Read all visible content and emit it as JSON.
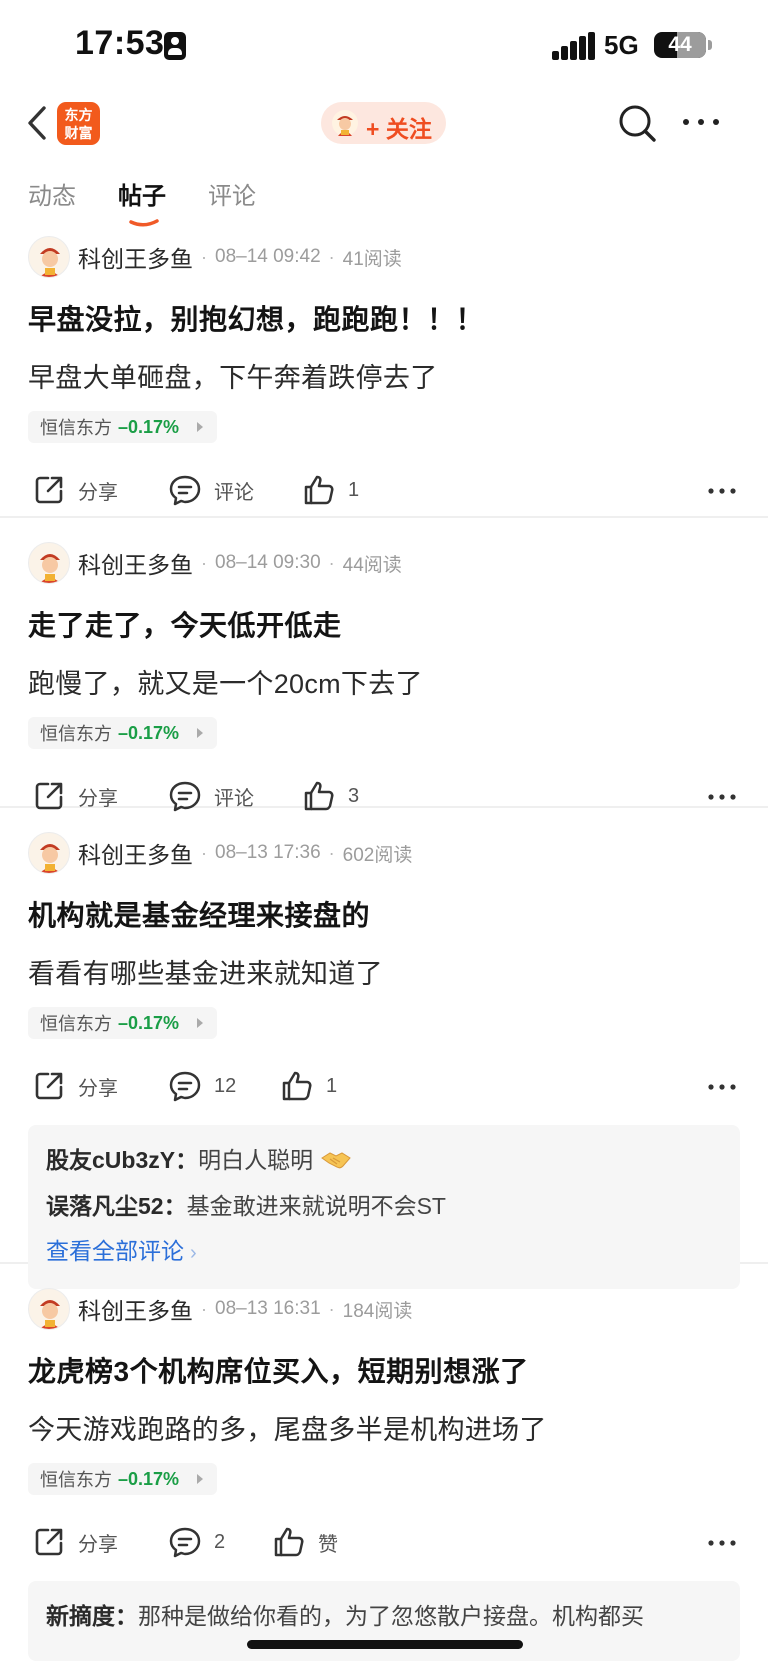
{
  "status_bar": {
    "time": "17:53",
    "network": "5G",
    "battery": "44",
    "battery_level": 0.44
  },
  "nav": {
    "logo_text": "东方财富",
    "follow_label": "+ 关注"
  },
  "tabs": [
    {
      "label": "动态",
      "active": false
    },
    {
      "label": "帖子",
      "active": true
    },
    {
      "label": "评论",
      "active": false
    }
  ],
  "posts": [
    {
      "author": "科创王多鱼",
      "time": "08–14 09:42",
      "reads": "41阅读",
      "title": "早盘没拉，别抱幻想，跑跑跑！！！",
      "body": "早盘大单砸盘，下午奔着跌停去了",
      "stock": {
        "name": "恒信东方",
        "change": "–0.17%"
      },
      "share": "分享",
      "comment": "评论",
      "like": "1"
    },
    {
      "author": "科创王多鱼",
      "time": "08–14 09:30",
      "reads": "44阅读",
      "title": "走了走了，今天低开低走",
      "body": "跑慢了，就又是一个20cm下去了",
      "stock": {
        "name": "恒信东方",
        "change": "–0.17%"
      },
      "share": "分享",
      "comment": "评论",
      "like": "3"
    },
    {
      "author": "科创王多鱼",
      "time": "08–13 17:36",
      "reads": "602阅读",
      "title": "机构就是基金经理来接盘的",
      "body": "看看有哪些基金进来就知道了",
      "stock": {
        "name": "恒信东方",
        "change": "–0.17%"
      },
      "share": "分享",
      "comment": "12",
      "like": "1",
      "comments": [
        {
          "user": "股友cUb3zY：",
          "text": "明白人聪明",
          "emoji": "handshake"
        },
        {
          "user": "误落凡尘52：",
          "text": "基金敢进来就说明不会ST"
        }
      ],
      "view_all": "查看全部评论"
    },
    {
      "author": "科创王多鱼",
      "time": "08–13 16:31",
      "reads": "184阅读",
      "title": "龙虎榜3个机构席位买入，短期别想涨了",
      "body": "今天游戏跑路的多，尾盘多半是机构进场了",
      "stock": {
        "name": "恒信东方",
        "change": "–0.17%"
      },
      "share": "分享",
      "comment": "2",
      "like": "赞",
      "comments": [
        {
          "user": "新摘度：",
          "text": "那种是做给你看的，为了忽悠散户接盘。机构都买"
        }
      ]
    }
  ]
}
